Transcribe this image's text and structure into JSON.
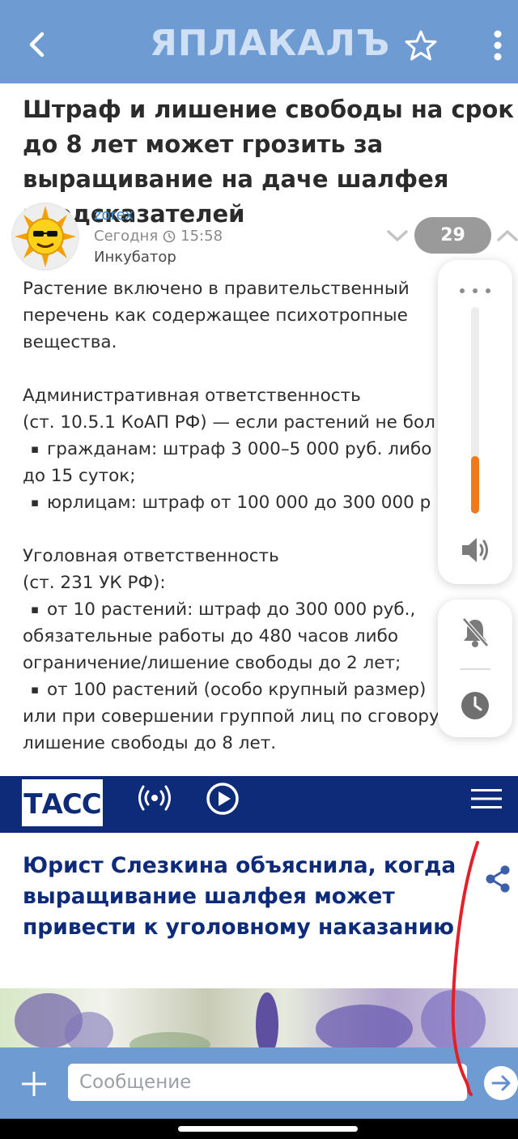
{
  "app": {
    "logo_text": "ЯПЛАКАЛЪ",
    "icons": {
      "back": "back-arrow-icon",
      "favorite": "star-icon",
      "more": "more-vert-icon"
    }
  },
  "post": {
    "title": "Штраф и лишение свободы на срок до 8 лет может грозить за выращивание на даче шалфея предсказателей",
    "author": "zorex",
    "date": "Сегодня",
    "time": "15:58",
    "section": "Инкубатор",
    "rating": "29",
    "body": {
      "p1": [
        "Растение включено в правительственный",
        "перечень как содержащее психотропные",
        "вещества."
      ],
      "admin_title": "Административная ответственность",
      "admin_ref": "(ст. 10.5.1 КоАП РФ) — если растений не бол",
      "admin_b1": "гражданам: штраф 3 000–5 000 руб. либо",
      "admin_b1_cont": "до 15 суток;",
      "admin_b2": "юрлицам: штраф от 100 000 до 300 000 р",
      "crim_title": "Уголовная ответственность",
      "crim_ref": "(ст. 231 УК РФ):",
      "crim_b1": "от 10 растений: штраф до 300 000 руб.,",
      "crim_b1_l2": "обязательные работы до 480 часов либо",
      "crim_b1_l3": "ограничение/лишение свободы до 2 лет;",
      "crim_b2": "от 100 растений (особо крупный размер)",
      "crim_b2_l2": "или при совершении группой лиц по сговору",
      "crim_b2_l3": "лишение свободы до 8 лет."
    }
  },
  "volume_overlay": {
    "level_fraction": 0.28,
    "accent_color": "#f07a1a",
    "icons": [
      "more-horiz-icon",
      "speaker-icon",
      "bell-off-icon",
      "clock-icon"
    ]
  },
  "embed": {
    "brand": "ТАСС",
    "headline": "Юрист Слезкина объяснила, когда выращивание шалфея может привести к уголовному наказанию",
    "icons": [
      "radio-icon",
      "play-icon",
      "menu-icon",
      "share-icon"
    ]
  },
  "composer": {
    "placeholder": "Сообщение",
    "icons": [
      "plus-icon",
      "send-icon"
    ]
  },
  "colors": {
    "bar": "#6f9bd3",
    "tass": "#0e2b7a",
    "link": "#3a86c8"
  }
}
